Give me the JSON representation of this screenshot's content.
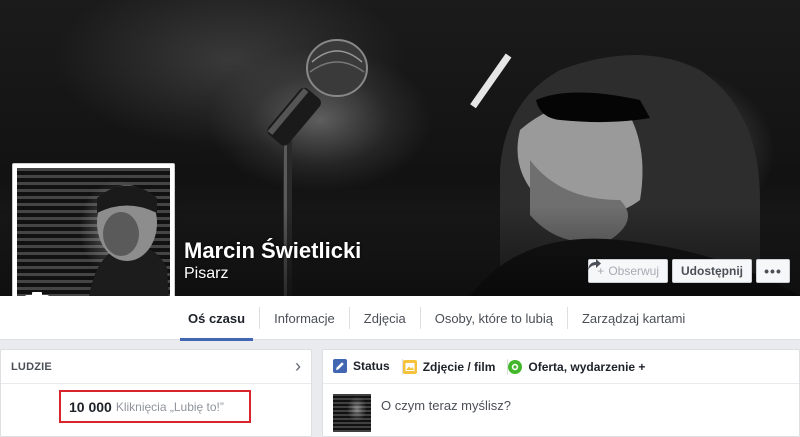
{
  "page": {
    "name": "Marcin Świetlicki",
    "category": "Pisarz"
  },
  "cover_actions": {
    "follow": "Obserwuj",
    "share": "Udostępnij",
    "more": "•••"
  },
  "nav": {
    "tabs": [
      {
        "label": "Oś czasu",
        "active": true
      },
      {
        "label": "Informacje"
      },
      {
        "label": "Zdjęcia"
      },
      {
        "label": "Osoby, które to lubią"
      },
      {
        "label": "Zarządzaj kartami"
      }
    ]
  },
  "people": {
    "title": "LUDZIE",
    "likes_count": "10 000",
    "likes_label": "Kliknięcia „Lubię to!”"
  },
  "composer": {
    "tabs": [
      {
        "label": "Status",
        "icon": "pencil-icon",
        "color": "#4267b2"
      },
      {
        "label": "Zdjęcie / film",
        "icon": "photo-icon",
        "color": "#f5c33b"
      },
      {
        "label": "Oferta, wydarzenie +",
        "icon": "offer-icon",
        "color": "#42b72a"
      }
    ],
    "placeholder": "O czym teraz myślisz?"
  },
  "colors": {
    "accent": "#4267b2",
    "highlight_border": "#d7252b"
  }
}
